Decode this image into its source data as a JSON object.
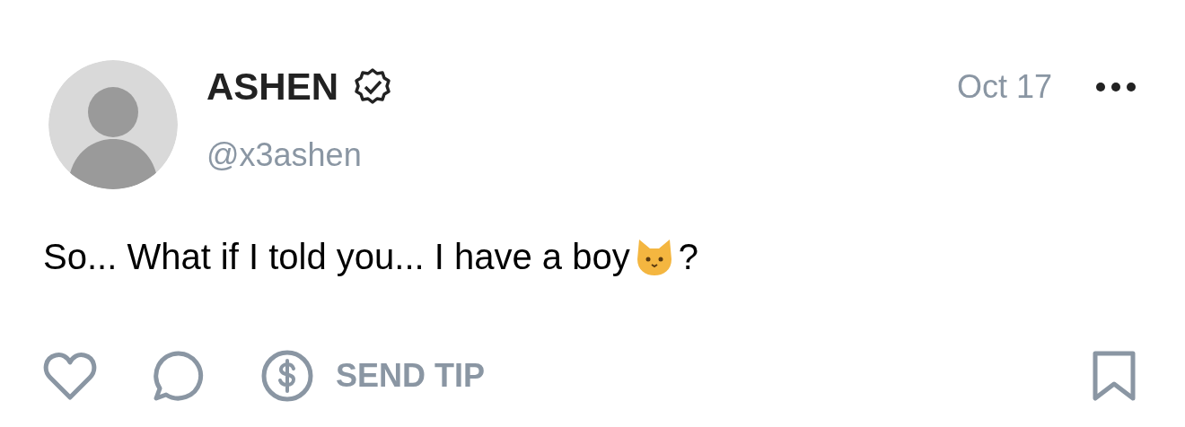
{
  "post": {
    "author": {
      "name": "ASHEN",
      "verified": true,
      "handle": "@x3ashen"
    },
    "date": "Oct 17",
    "text": "So... What if I told you... I have a boy",
    "text_end": "?",
    "actions": {
      "tip_label": "SEND TIP",
      "bookmarked": false,
      "liked": false
    }
  }
}
